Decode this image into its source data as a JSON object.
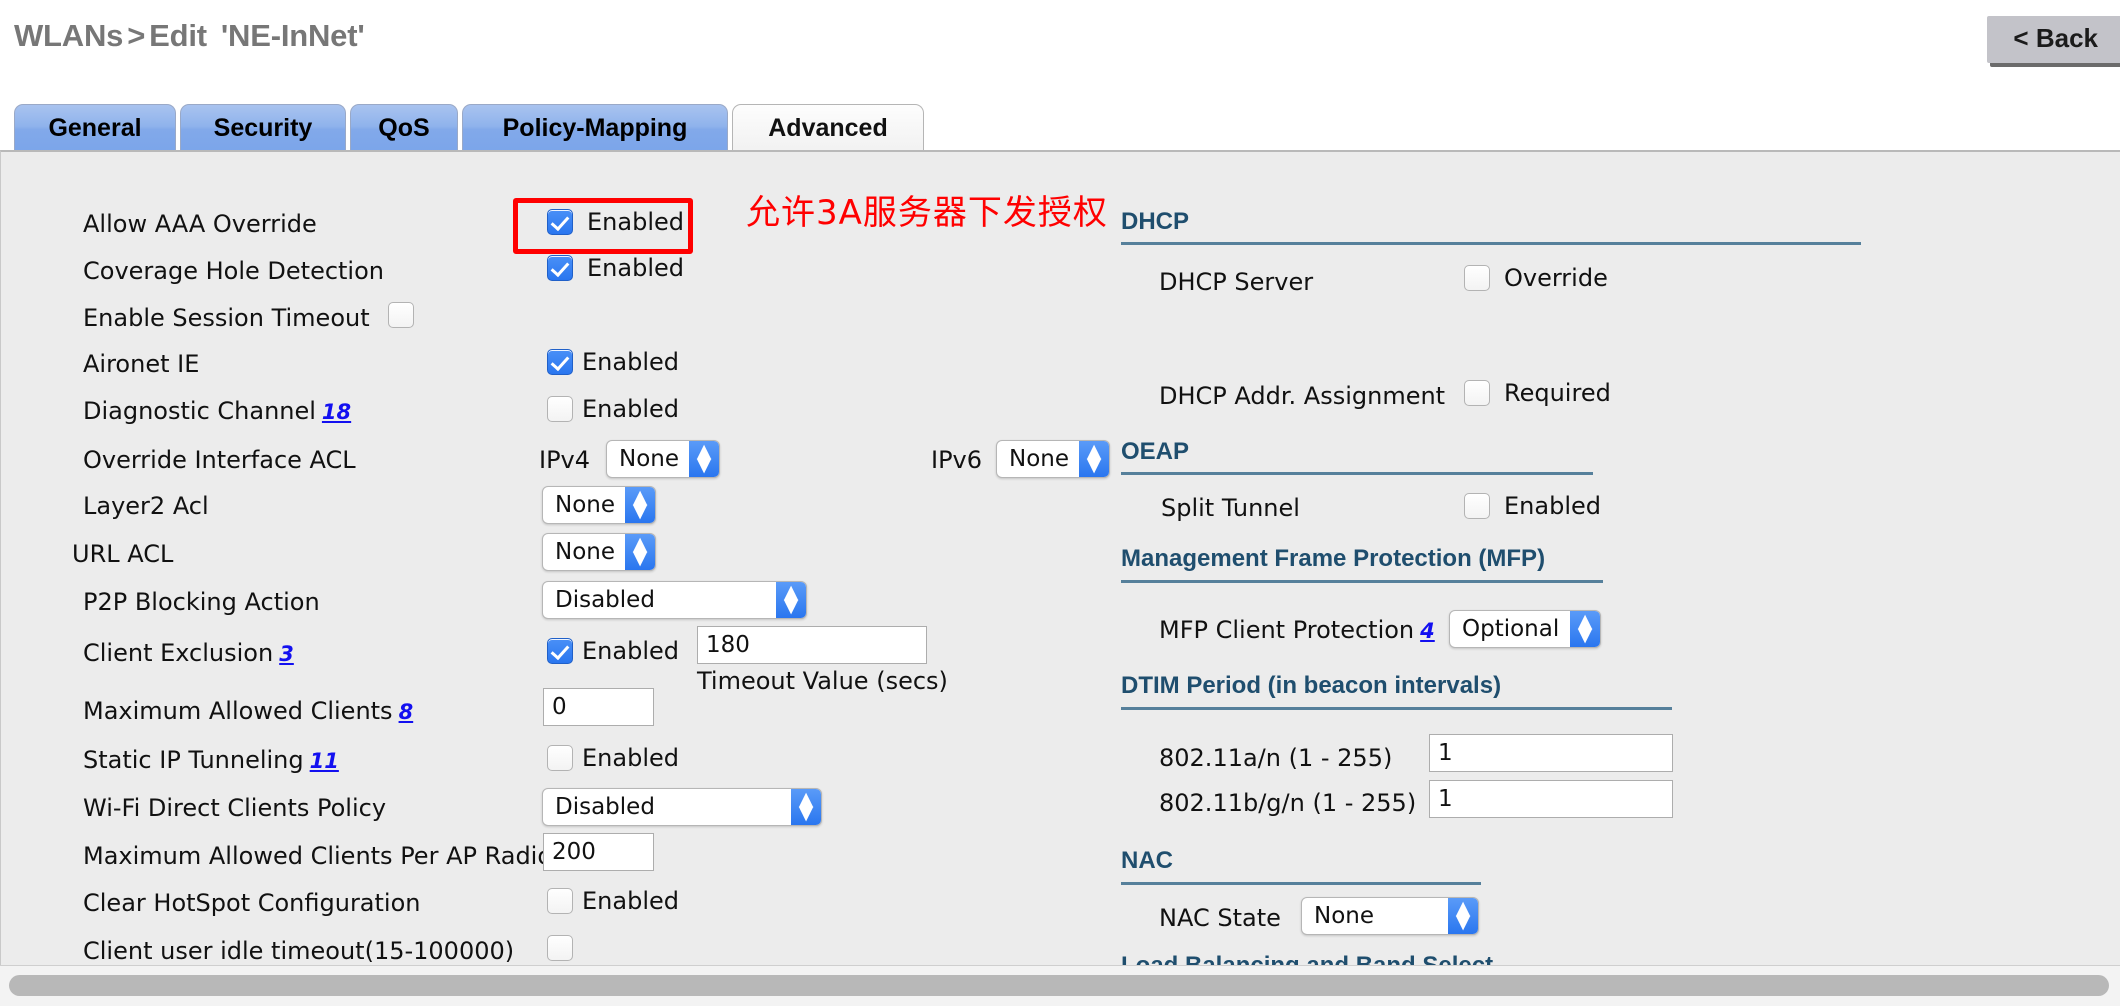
{
  "header": {
    "breadcrumb_root": "WLANs",
    "breadcrumb_sep": ">",
    "breadcrumb_action": "Edit",
    "ssid": "'NE-InNet'",
    "back_label": "< Back"
  },
  "tabs": [
    {
      "label": "General",
      "active": false
    },
    {
      "label": "Security",
      "active": false
    },
    {
      "label": "QoS",
      "active": false
    },
    {
      "label": "Policy-Mapping",
      "active": false
    },
    {
      "label": "Advanced",
      "active": true
    }
  ],
  "annotation": {
    "text": "允许3A服务器下发授权",
    "color": "#ff0000"
  },
  "left": {
    "rows": [
      {
        "label": "Allow AAA Override",
        "note": "",
        "control": "checkbox",
        "checked": true,
        "text": "Enabled"
      },
      {
        "label": "Coverage Hole Detection",
        "note": "",
        "control": "checkbox",
        "checked": true,
        "text": "Enabled"
      },
      {
        "label": "Enable Session Timeout",
        "note": "",
        "control": "checkbox",
        "checked": false,
        "text": ""
      },
      {
        "label": "Aironet IE",
        "note": "",
        "control": "checkbox",
        "checked": true,
        "text": "Enabled"
      },
      {
        "label": "Diagnostic Channel",
        "note": "18",
        "control": "checkbox",
        "checked": false,
        "text": "Enabled"
      },
      {
        "label": "Override Interface ACL",
        "note": "",
        "control": "acl-pair"
      },
      {
        "label": "Layer2 Acl",
        "note": "",
        "control": "select",
        "value": "None"
      },
      {
        "label": "URL ACL",
        "note": "",
        "control": "select",
        "value": "None"
      },
      {
        "label": "P2P Blocking Action",
        "note": "",
        "control": "select",
        "value": "Disabled"
      },
      {
        "label": "Client Exclusion",
        "note": "3",
        "control": "exclusion",
        "checked": true,
        "text": "Enabled",
        "value": "180",
        "sub": "Timeout Value (secs)"
      },
      {
        "label": "Maximum Allowed Clients",
        "note": "8",
        "control": "input",
        "value": "0"
      },
      {
        "label": "Static IP Tunneling",
        "note": "11",
        "control": "checkbox",
        "checked": false,
        "text": "Enabled"
      },
      {
        "label": "Wi-Fi Direct Clients Policy",
        "note": "",
        "control": "select",
        "value": "Disabled"
      },
      {
        "label": "Maximum Allowed Clients Per AP Radio",
        "note": "",
        "control": "input",
        "value": "200"
      },
      {
        "label": "Clear HotSpot Configuration",
        "note": "",
        "control": "checkbox",
        "checked": false,
        "text": "Enabled"
      },
      {
        "label": "Client user idle timeout(15-100000)",
        "note": "",
        "control": "checkbox",
        "checked": false,
        "text": ""
      }
    ],
    "acl": {
      "ipv4_label": "IPv4",
      "ipv4_value": "None",
      "ipv6_label": "IPv6",
      "ipv6_value": "None"
    }
  },
  "right": {
    "dhcp": {
      "heading": "DHCP",
      "server_label": "DHCP Server",
      "server_cb_text": "Override",
      "server_checked": false,
      "assign_label": "DHCP Addr. Assignment",
      "assign_cb_text": "Required",
      "assign_checked": false
    },
    "oeap": {
      "heading": "OEAP",
      "split_label": "Split Tunnel",
      "split_cb_text": "Enabled",
      "split_checked": false
    },
    "mfp": {
      "heading": "Management Frame Protection (MFP)",
      "client_label": "MFP Client Protection",
      "client_note": "4",
      "client_value": "Optional"
    },
    "dtim": {
      "heading": "DTIM Period (in beacon intervals)",
      "a_label": "802.11a/n (1 - 255)",
      "a_value": "1",
      "b_label": "802.11b/g/n (1 - 255)",
      "b_value": "1"
    },
    "nac": {
      "heading": "NAC",
      "state_label": "NAC State",
      "state_value": "None"
    },
    "load_balancing": {
      "heading": "Load Balancing and Band Select"
    }
  },
  "icons": {
    "chevron_up": "▴",
    "chevron_down": "▾"
  }
}
